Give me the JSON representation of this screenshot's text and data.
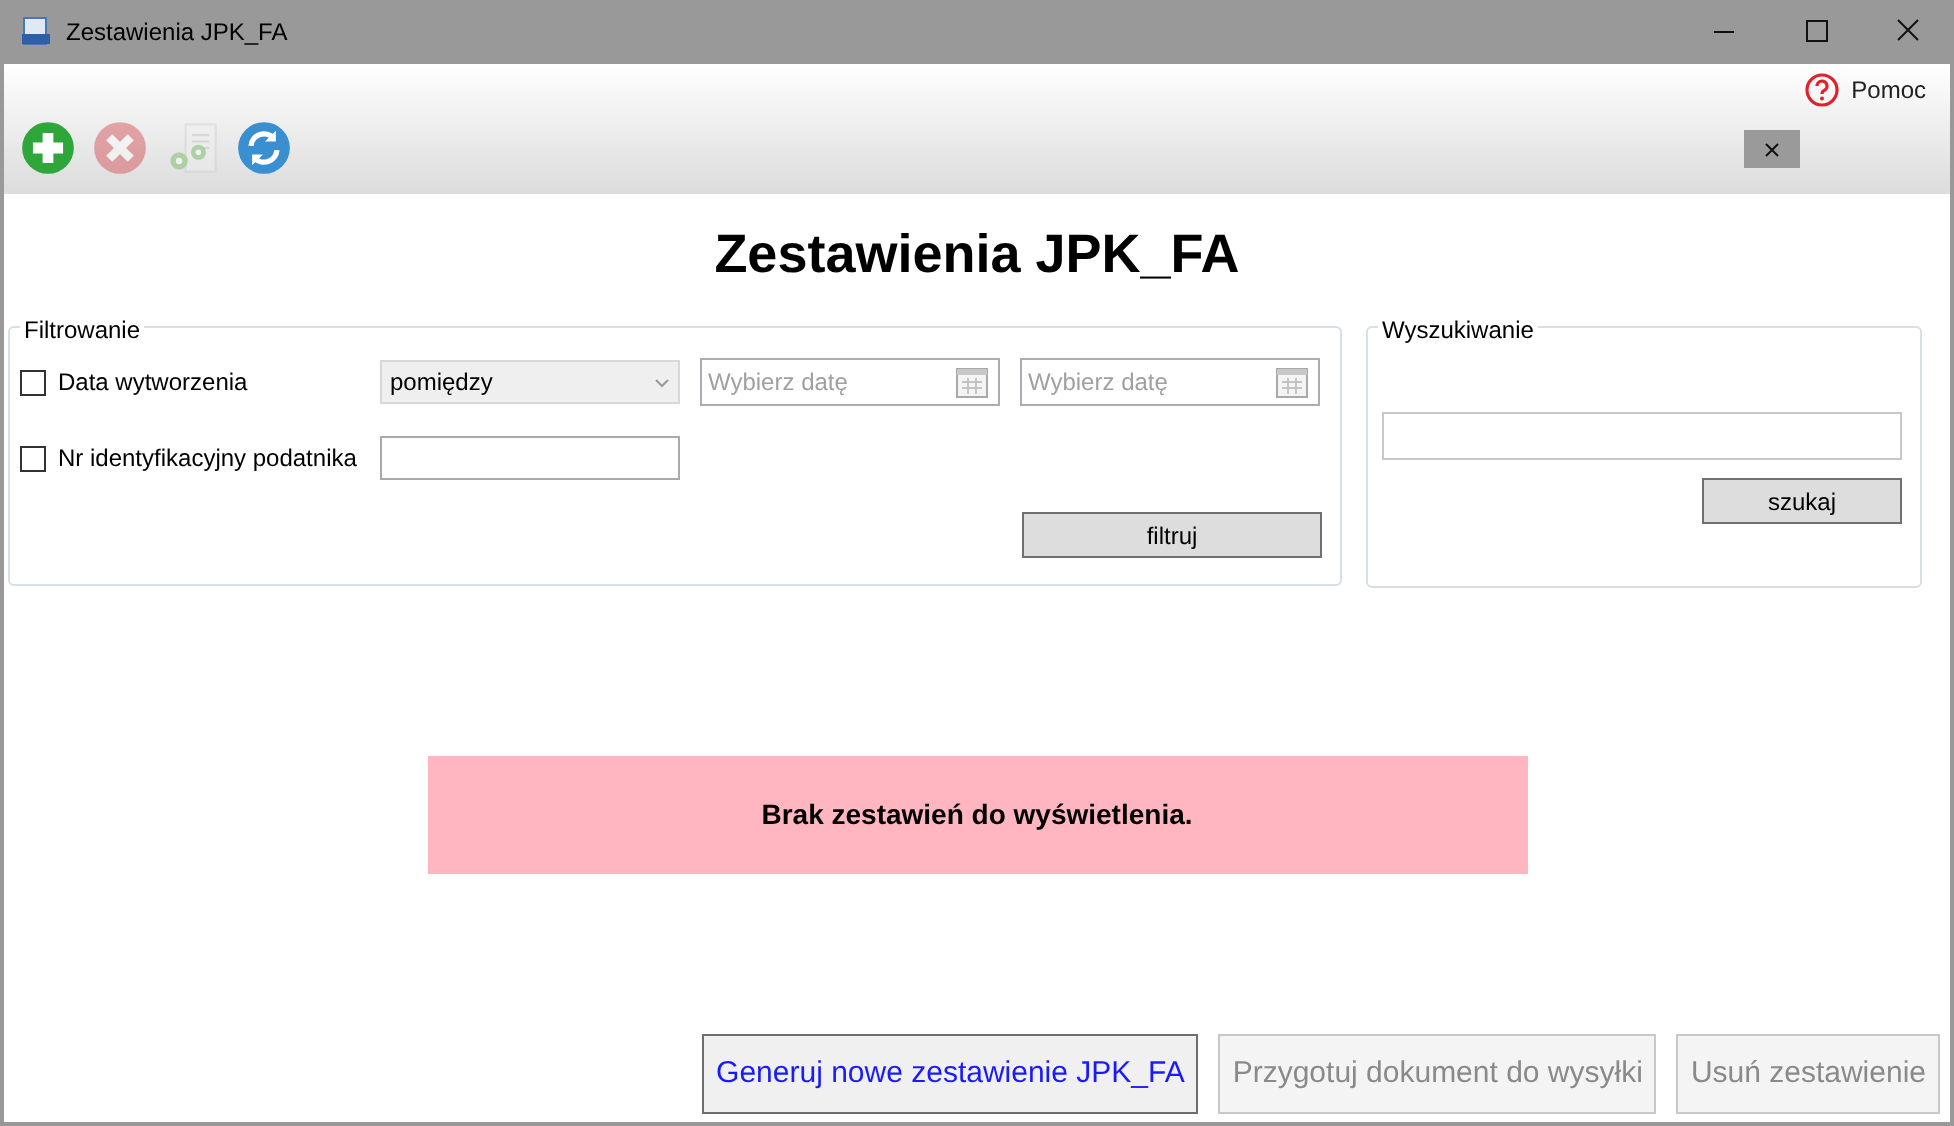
{
  "window": {
    "title": "Zestawienia JPK_FA"
  },
  "help": {
    "label": "Pomoc"
  },
  "toolbar": [
    {
      "kind": "add",
      "disabled": false
    },
    {
      "kind": "delete",
      "disabled": true
    },
    {
      "kind": "generate",
      "disabled": true
    },
    {
      "kind": "refresh",
      "disabled": false
    }
  ],
  "heading": "Zestawienia JPK_FA",
  "filter": {
    "title": "Filtrowanie",
    "date_row": {
      "label": "Data wytworzenia",
      "checked": false,
      "mode": "pomiędzy",
      "from_placeholder": "Wybierz datę",
      "to_placeholder": "Wybierz datę"
    },
    "taxid_row": {
      "label": "Nr identyfikacyjny podatnika",
      "checked": false
    },
    "button": "filtruj"
  },
  "search": {
    "title": "Wyszukiwanie",
    "button": "szukaj"
  },
  "message": "Brak zestawień do wyświetlenia.",
  "actions": [
    {
      "label": "Generuj nowe zestawienie JPK_FA",
      "disabled": false
    },
    {
      "label": "Przygotuj dokument do wysyłki",
      "disabled": true
    },
    {
      "label": "Usuń zestawienie",
      "disabled": true
    }
  ]
}
